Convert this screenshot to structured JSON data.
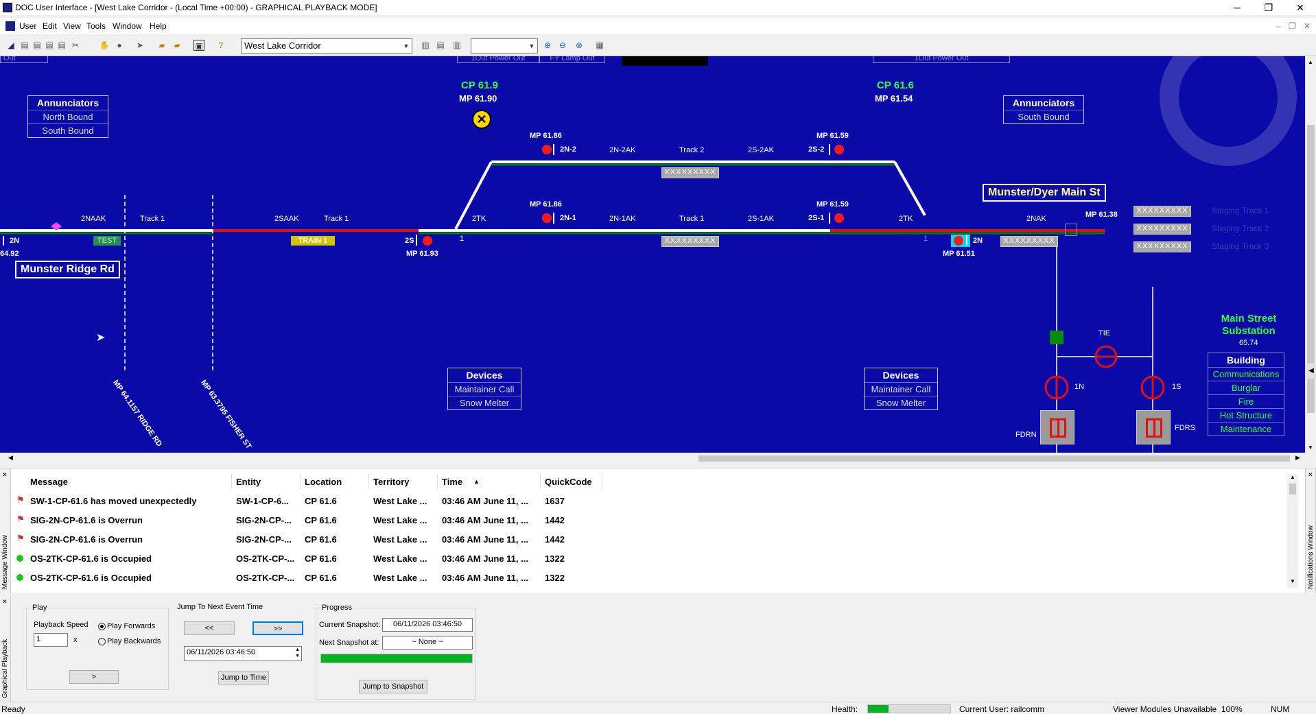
{
  "window": {
    "title": "DOC User Interface - [West Lake Corridor - (Local Time +00:00) - GRAPHICAL PLAYBACK MODE]",
    "min": "─",
    "max": "❐",
    "close": "✕"
  },
  "menu": [
    "User",
    "Edit",
    "View",
    "Tools",
    "Window",
    "Help"
  ],
  "toolbar": {
    "territory": "West Lake Corridor",
    "zoom": ""
  },
  "canvas": {
    "top_labels": [
      "Out",
      "1Out Power Out",
      "FY Lamp Out",
      "1Out Power Out"
    ],
    "cp_left": {
      "name": "CP 61.9",
      "mp": "MP 61.90"
    },
    "cp_right": {
      "name": "CP 61.6",
      "mp": "MP 61.54"
    },
    "annunciators_left": {
      "title": "Annunciators",
      "rows": [
        "North Bound",
        "South Bound"
      ]
    },
    "annunciators_right": {
      "title": "Annunciators",
      "rows": [
        "South Bound"
      ]
    },
    "track_labels": {
      "mp_2n2": "MP 61.86",
      "sig_2n2": "2N-2",
      "ak_2n2": "2N-2AK",
      "track2": "Track 2",
      "ak_2s2": "2S-2AK",
      "mp_2s2": "MP 61.59",
      "sig_2s2": "2S-2",
      "mp_2n1": "MP 61.86",
      "sig_2n1": "2N-1",
      "ak_2n1": "2N-1AK",
      "track1_mid": "Track 1",
      "ak_2s1": "2S-1AK",
      "mp_2s1": "MP 61.59",
      "sig_2s1": "2S-1",
      "naak": "2NAAK",
      "track1_a": "Track 1",
      "saak": "2SAAK",
      "track1_b": "Track 1",
      "tk_left": "2TK",
      "tk_right": "2TK",
      "nak": "2NAK",
      "mp_6138": "MP 61.38",
      "sig_2n_left": "2N",
      "mp_left": "64.92",
      "test": "TEST",
      "train1": "TRAIN 1",
      "sig_2s": "2S",
      "mp_6193": "MP 61.93",
      "one_left": "1",
      "one_right": "1",
      "sig_2n_right": "2N",
      "mp_6151": "MP 61.51",
      "grey": "XXXXXXXXX"
    },
    "munster_ridge": "Munster Ridge Rd",
    "munster_dyer": "Munster/Dyer Main St",
    "staging": [
      "Staging Track 1",
      "Staging Track 2",
      "Staging Track 3"
    ],
    "mp_ridge": "MP 64.1157 RIDGE RD",
    "mp_fisher": "MP 63.3795 FISHER ST",
    "devices_left": {
      "title": "Devices",
      "rows": [
        "Maintainer Call",
        "Snow Melter"
      ]
    },
    "devices_right": {
      "title": "Devices",
      "rows": [
        "Maintainer Call",
        "Snow Melter"
      ]
    },
    "substation": {
      "title": "Main Street Substation",
      "value": "65.74",
      "tie": "TIE",
      "n1": "1N",
      "s1": "1S",
      "fdrn": "FDRN",
      "fdrs": "FDRS"
    },
    "building": {
      "title": "Building",
      "rows": [
        "Communications",
        "Burglar",
        "Fire",
        "Hot Structure",
        "Maintenance"
      ]
    }
  },
  "messages": {
    "side_label": "Message Window",
    "notif_label": "Notifications Window",
    "headers": [
      "Message",
      "Entity",
      "Location",
      "Territory",
      "Time",
      "QuickCode"
    ],
    "rows": [
      {
        "msg": "SW-1-CP-61.6 has moved unexpectedly",
        "entity": "SW-1-CP-6...",
        "loc": "CP 61.6",
        "terr": "West Lake ...",
        "time": "03:46 AM June 11, ...",
        "code": "1637",
        "icon": "flag"
      },
      {
        "msg": "SIG-2N-CP-61.6 is Overrun",
        "entity": "SIG-2N-CP-...",
        "loc": "CP 61.6",
        "terr": "West Lake ...",
        "time": "03:46 AM June 11, ...",
        "code": "1442",
        "icon": "flag"
      },
      {
        "msg": "SIG-2N-CP-61.6 is Overrun",
        "entity": "SIG-2N-CP-...",
        "loc": "CP 61.6",
        "terr": "West Lake ...",
        "time": "03:46 AM June 11, ...",
        "code": "1442",
        "icon": "flag"
      },
      {
        "msg": "OS-2TK-CP-61.6 is Occupied",
        "entity": "OS-2TK-CP-...",
        "loc": "CP 61.6",
        "terr": "West Lake ...",
        "time": "03:46 AM June 11, ...",
        "code": "1322",
        "icon": "dot"
      },
      {
        "msg": "OS-2TK-CP-61.6 is Occupied",
        "entity": "OS-2TK-CP-...",
        "loc": "CP 61.6",
        "terr": "West Lake ...",
        "time": "03:46 AM June 11, ...",
        "code": "1322",
        "icon": "dot"
      }
    ]
  },
  "playback": {
    "side_label": "Graphical Playback",
    "play_title": "Play",
    "speed_label": "Playback Speed",
    "speed": "1",
    "x": "x",
    "fwd": "Play Forwards",
    "back": "Play Backwards",
    "play_btn": ">",
    "jump_title": "Jump To Next Event Time",
    "prev": "<<",
    "next": ">>",
    "time": "06/11/2026 03:46:50",
    "jump_time": "Jump to Time",
    "progress_title": "Progress",
    "cur_label": "Current Snapshot:",
    "cur": "06/11/2026 03:46:50",
    "next_label": "Next Snapshot at:",
    "next_val": "~ None ~",
    "jump_snap": "Jump to Snapshot",
    "progress": 1.0
  },
  "status": {
    "ready": "Ready",
    "health": "Health:",
    "user": "Current User: railcomm",
    "modules": "Viewer Modules Unavailable",
    "zoom": "100%",
    "num": "NUM"
  }
}
